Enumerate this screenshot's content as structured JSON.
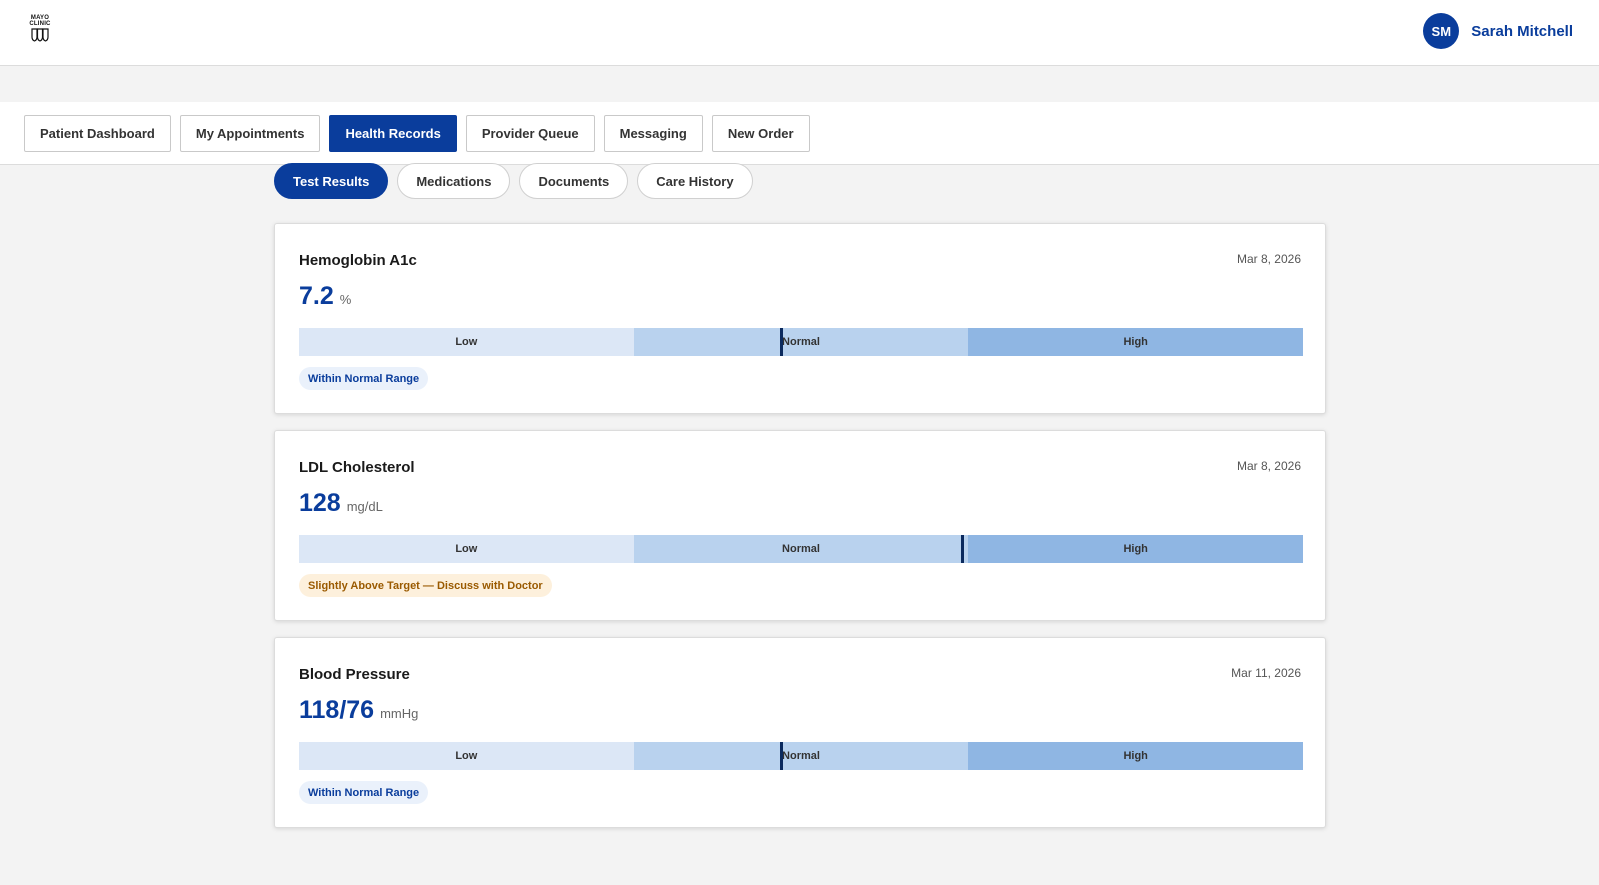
{
  "brand": {
    "logo_lines": [
      "MAYO",
      "CLINIC"
    ]
  },
  "user": {
    "initials": "SM",
    "name": "Sarah Mitchell"
  },
  "nav": {
    "tabs": [
      {
        "label": "Patient Dashboard",
        "active": false
      },
      {
        "label": "My Appointments",
        "active": false
      },
      {
        "label": "Health Records",
        "active": true
      },
      {
        "label": "Provider Queue",
        "active": false
      },
      {
        "label": "Messaging",
        "active": false
      },
      {
        "label": "New Order",
        "active": false
      }
    ]
  },
  "subtabs": [
    {
      "label": "Test Results",
      "active": true
    },
    {
      "label": "Medications",
      "active": false
    },
    {
      "label": "Documents",
      "active": false
    },
    {
      "label": "Care History",
      "active": false
    }
  ],
  "range_labels": {
    "low": "Low",
    "normal": "Normal",
    "high": "High"
  },
  "results": [
    {
      "title": "Hemoglobin A1c",
      "date": "Mar 8, 2026",
      "value": "7.2",
      "unit": "%",
      "marker_percent": 48,
      "status": "Within Normal Range",
      "status_kind": "normal"
    },
    {
      "title": "LDL Cholesterol",
      "date": "Mar 8, 2026",
      "value": "128",
      "unit": "mg/dL",
      "marker_percent": 66,
      "status": "Slightly Above Target — Discuss with Doctor",
      "status_kind": "warn"
    },
    {
      "title": "Blood Pressure",
      "date": "Mar 11, 2026",
      "value": "118/76",
      "unit": "mmHg",
      "marker_percent": 48,
      "status": "Within Normal Range",
      "status_kind": "normal"
    }
  ],
  "colors": {
    "primary": "#0a3d9c",
    "marker": "#0b2a5e",
    "warn_text": "#9a5a00",
    "warn_bg": "#fdf0dc"
  }
}
